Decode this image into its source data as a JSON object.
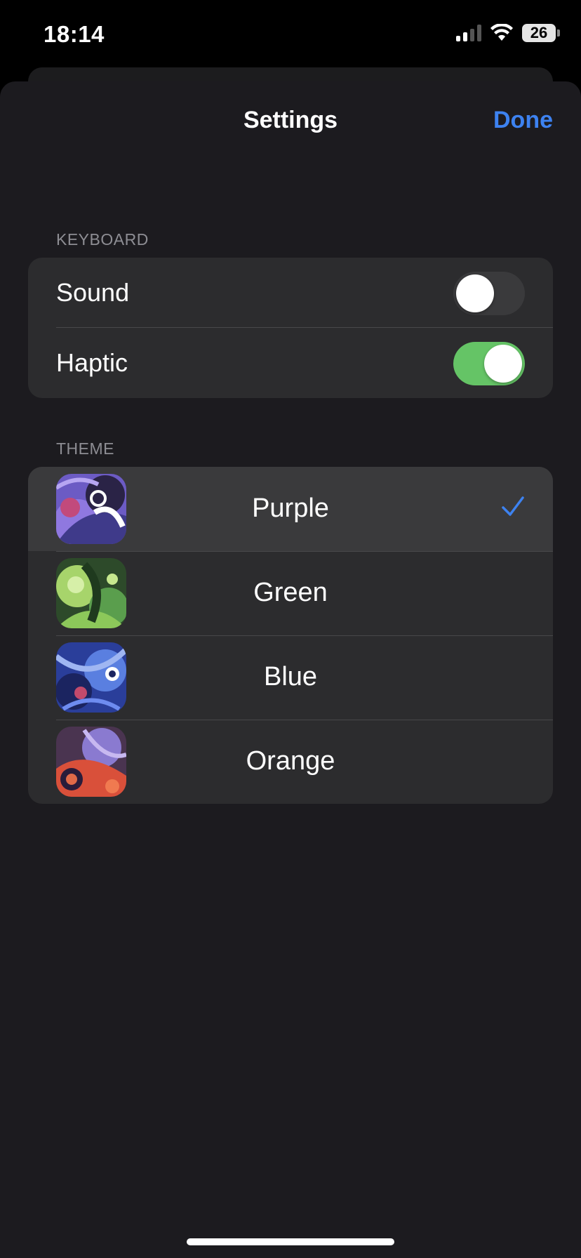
{
  "status_bar": {
    "time": "18:14",
    "battery": "26"
  },
  "nav": {
    "title": "Settings",
    "done_label": "Done"
  },
  "keyboard": {
    "header": "KEYBOARD",
    "items": [
      {
        "label": "Sound",
        "enabled": false
      },
      {
        "label": "Haptic",
        "enabled": true
      }
    ]
  },
  "theme": {
    "header": "THEME",
    "items": [
      {
        "label": "Purple",
        "selected": true,
        "thumb_icon": "purple-theme-thumbnail"
      },
      {
        "label": "Green",
        "selected": false,
        "thumb_icon": "green-theme-thumbnail"
      },
      {
        "label": "Blue",
        "selected": false,
        "thumb_icon": "blue-theme-thumbnail"
      },
      {
        "label": "Orange",
        "selected": false,
        "thumb_icon": "orange-theme-thumbnail"
      }
    ]
  },
  "colors": {
    "accent": "#3d82f0",
    "toggle_on": "#65c466",
    "background": "#1c1b1f",
    "group_background": "#2c2c2e"
  }
}
